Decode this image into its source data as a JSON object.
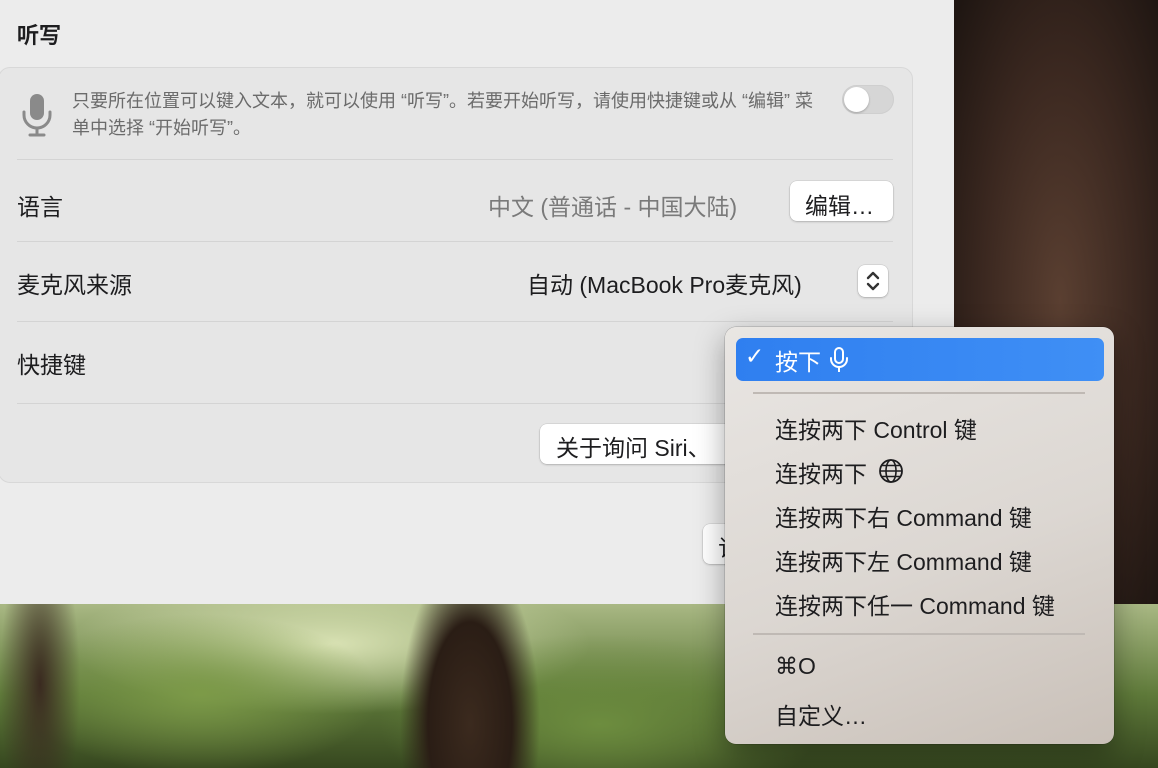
{
  "section": {
    "title": "听写"
  },
  "dictation": {
    "description": "只要所在位置可以键入文本，就可以使用 “听写”。若要开始听写，请使用快捷键或从 “编辑” 菜单中选择 “开始听写”。",
    "toggle_on": false
  },
  "language": {
    "label": "语言",
    "value": "中文 (普通话 - 中国大陆)",
    "edit_button": "编辑…"
  },
  "microphone": {
    "label": "麦克风来源",
    "value": "自动 (MacBook Pro麦克风)"
  },
  "shortcut": {
    "label": "快捷键"
  },
  "about_button": "关于询问 Siri、",
  "partial_button": "订",
  "menu": {
    "checkmark": "✓",
    "items": [
      {
        "label": "按下",
        "icon": "mic-icon",
        "selected": true
      },
      {
        "label": "连按两下 Control 键"
      },
      {
        "label": "连按两下",
        "icon": "globe-icon"
      },
      {
        "label": "连按两下右 Command 键"
      },
      {
        "label": "连按两下左 Command 键"
      },
      {
        "label": "连按两下任一 Command 键"
      },
      {
        "label": "⌘O"
      },
      {
        "label": "自定义…"
      }
    ]
  },
  "colors": {
    "accent": "#2f7ff0",
    "window_bg": "#ececec"
  }
}
